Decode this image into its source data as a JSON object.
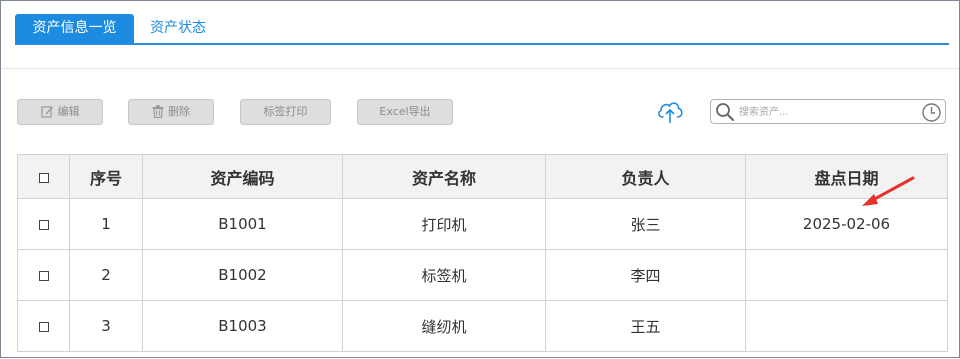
{
  "tabs": [
    {
      "label": "资产信息一览",
      "active": true
    },
    {
      "label": "资产状态",
      "active": false
    }
  ],
  "toolbar": {
    "edit_label": "编辑",
    "delete_label": "删除",
    "print_label": "标签打印",
    "export_label": "Excel导出",
    "cloud_icon": "cloud-upload-icon"
  },
  "search": {
    "placeholder": "搜索资产...",
    "value": ""
  },
  "table": {
    "columns": [
      "序号",
      "资产编码",
      "资产名称",
      "负责人",
      "盘点日期"
    ],
    "rows": [
      {
        "no": "1",
        "code": "B1001",
        "name": "打印机",
        "owner": "张三",
        "date": "2025-02-06"
      },
      {
        "no": "2",
        "code": "B1002",
        "name": "标签机",
        "owner": "李四",
        "date": ""
      },
      {
        "no": "3",
        "code": "B1003",
        "name": "缝纫机",
        "owner": "王五",
        "date": ""
      }
    ]
  },
  "colors": {
    "accent": "#1d8ce0",
    "annotation_arrow": "#e5322d",
    "button_bg": "#dedede",
    "header_bg": "#f2f2f2"
  }
}
